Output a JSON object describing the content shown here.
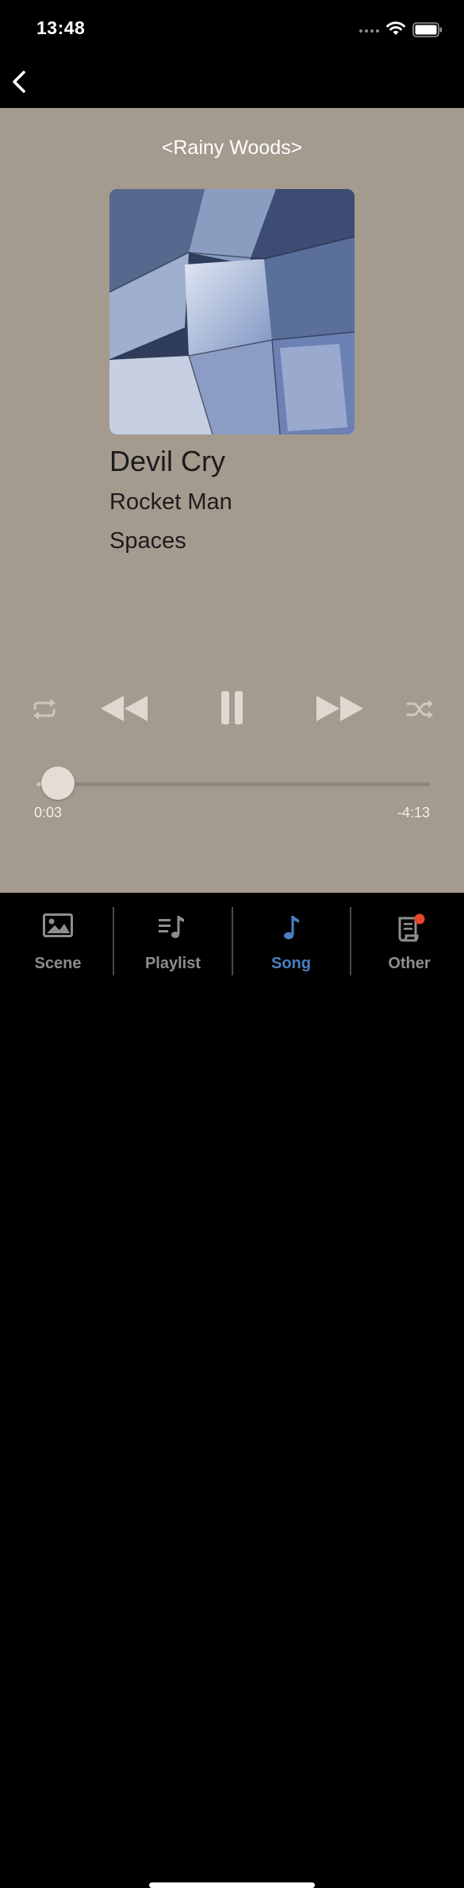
{
  "status_bar": {
    "time": "13:48"
  },
  "header": {
    "scene_name": "<Rainy Woods>"
  },
  "track": {
    "title": "Devil Cry",
    "artist": "Rocket Man",
    "album": "Spaces",
    "artwork": "geometric-glass-architecture-sky"
  },
  "controls": {
    "repeat_icon": "repeat-icon",
    "rewind_icon": "rewind-icon",
    "pause_icon": "pause-icon",
    "forward_icon": "fast-forward-icon",
    "shuffle_icon": "shuffle-icon"
  },
  "progress": {
    "elapsed": "0:03",
    "remaining": "-4:13",
    "fraction": 0.012
  },
  "tabs": [
    {
      "label": "Scene",
      "icon": "image-icon",
      "active": false
    },
    {
      "label": "Playlist",
      "icon": "playlist-icon",
      "active": false
    },
    {
      "label": "Song",
      "icon": "music-note-icon",
      "active": true
    },
    {
      "label": "Other",
      "icon": "document-icon",
      "active": false,
      "badge": true
    }
  ],
  "colors": {
    "player_background": "#a59a8e",
    "accent": "#4a7fc1",
    "badge": "#e8462f",
    "inactive_tab": "#8e8e8e"
  }
}
